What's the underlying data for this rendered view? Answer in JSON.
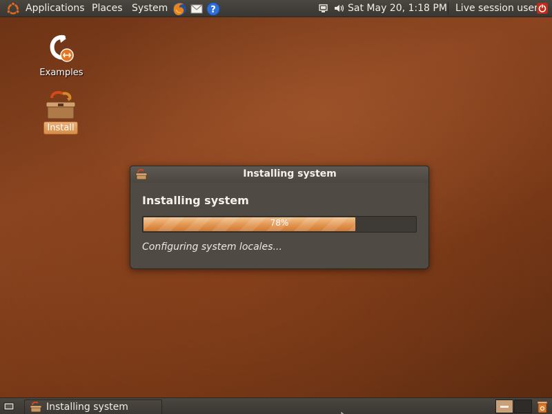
{
  "top_panel": {
    "menus": [
      "Applications",
      "Places",
      "System"
    ],
    "clock": "Sat May 20,  1:18 PM",
    "user": "Live session user",
    "icons": [
      "ubuntu-logo-icon",
      "firefox-icon",
      "mail-icon",
      "help-icon",
      "network-icon",
      "volume-icon",
      "power-icon"
    ]
  },
  "desktop": {
    "icons": [
      {
        "label": "Examples",
        "icon": "examples-icon"
      },
      {
        "label": "Install",
        "icon": "install-icon",
        "selected": true
      }
    ]
  },
  "dialog": {
    "title": "Installing system",
    "heading": "Installing system",
    "progress_fraction": 0.78,
    "progress_label": "78%",
    "status": "Configuring system locales..."
  },
  "bottom_panel": {
    "task_label": "Installing system",
    "icons": [
      "show-desktop-icon",
      "installer-task-icon",
      "workspace-switcher-icon",
      "trash-icon"
    ]
  },
  "colors": {
    "desktop_bg": "#7b3a18",
    "panel_bg": "#3f3b36",
    "accent": "#e0914a"
  }
}
